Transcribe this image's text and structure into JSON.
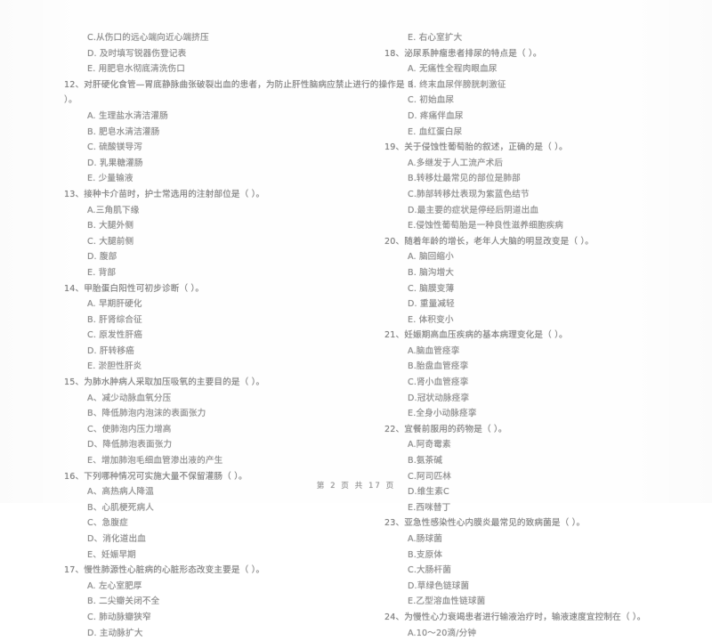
{
  "document": {
    "footer": "第 2 页 共 17 页"
  },
  "left_column": {
    "carryover_options": [
      "C.从伤口的远心端向近心端挤压",
      "D. 及时填写锐器伤登记表",
      "E. 用肥皂水彻底清洗伤口"
    ],
    "questions": [
      {
        "number": "12、",
        "stem": "对肝硬化食管—胃底静脉曲张破裂出血的患者，为防止肝性脑病应禁止进行的操作是（",
        "stem_cont": "）。",
        "options": [
          "A. 生理盐水清洁灌肠",
          "B. 肥皂水清洁灌肠",
          "C. 硫酸镁导泻",
          "D. 乳果糖灌肠",
          "E. 少量输液"
        ]
      },
      {
        "number": "13、",
        "stem": "接种卡介苗时，护士常选用的注射部位是（      ）。",
        "stem_cont": "",
        "options": [
          "A.三角肌下缘",
          "B. 大腿外侧",
          "C. 大腿前侧",
          "D. 腹部",
          "E. 背部"
        ]
      },
      {
        "number": "14、",
        "stem": "甲胎蛋白阳性可初步诊断（      ）。",
        "stem_cont": "",
        "options": [
          "A. 早期肝硬化",
          "B. 肝肾综合征",
          "C. 原发性肝癌",
          "D. 肝转移癌",
          "E. 淤胆性肝炎"
        ]
      },
      {
        "number": "15、",
        "stem": "为肺水肿病人采取加压吸氧的主要目的是（      ）。",
        "stem_cont": "",
        "options": [
          "A、减少动脉血氧分压",
          "B、降低肺泡内泡沫的表面张力",
          "C、使肺泡内压力增高",
          "D、降低肺泡表面张力",
          "E、增加肺泡毛细血管渗出液的产生"
        ]
      },
      {
        "number": "16、",
        "stem": "下列哪种情况可实施大量不保留灌肠（      ）。",
        "stem_cont": "",
        "options": [
          "A、高热病人降温",
          "B、心肌梗死病人",
          "C、急腹症",
          "D、消化道出血",
          "E、妊娠早期"
        ]
      },
      {
        "number": "17、",
        "stem": "慢性肺源性心脏病的心脏形态改变主要是（      ）。",
        "stem_cont": "",
        "options": [
          "A. 左心室肥厚",
          "B. 二尖瓣关闭不全",
          "C. 肺动脉瓣狭窄",
          "D. 主动脉扩大"
        ]
      }
    ]
  },
  "right_column": {
    "carryover_options": [
      "E. 右心室扩大"
    ],
    "questions": [
      {
        "number": "18、",
        "stem": "泌尿系肿瘤患者排尿的特点是（      ）。",
        "stem_cont": "",
        "options": [
          "A. 无痛性全程肉眼血尿",
          "B. 终末血尿伴膀胱刺激征",
          "C. 初始血尿",
          "D. 疼痛伴血尿",
          "E. 血红蛋白尿"
        ]
      },
      {
        "number": "19、",
        "stem": "关于侵蚀性葡萄胎的叙述，正确的是（      ）。",
        "stem_cont": "",
        "options": [
          "A.多继发于人工流产术后",
          "B.转移灶最常见的部位是肺部",
          "C.肺部转移灶表现为紫蓝色结节",
          "D.最主要的症状是停经后阴道出血",
          "E.侵蚀性葡萄胎是一种良性滋养细胞疾病"
        ]
      },
      {
        "number": "20、",
        "stem": "随着年龄的增长，老年人大脑的明显改变是（      ）。",
        "stem_cont": "",
        "options": [
          "A. 脑回缩小",
          "B. 脑沟增大",
          "C. 脑膜变薄",
          "D. 重量减轻",
          "E. 体积变小"
        ]
      },
      {
        "number": "21、",
        "stem": "妊娠期高血压疾病的基本病理变化是（      ）。",
        "stem_cont": "",
        "options": [
          "A.脑血管痉挛",
          "B.胎盘血管痉挛",
          "C.肾小血管痉挛",
          "D.冠状动脉痉挛",
          "E.全身小动脉痉挛"
        ]
      },
      {
        "number": "22、",
        "stem": "宜餐前服用的药物是（      ）。",
        "stem_cont": "",
        "options": [
          "A.阿奇霉素",
          "B.氨茶碱",
          "C.阿司匹林",
          "D.维生素C",
          "E.西咪替丁"
        ]
      },
      {
        "number": "23、",
        "stem": "亚急性感染性心内膜炎最常见的致病菌是（      ）。",
        "stem_cont": "",
        "options": [
          "A.肠球菌",
          "B.支原体",
          "C.大肠杆菌",
          "D.草绿色链球菌",
          "E.乙型溶血性链球菌"
        ]
      },
      {
        "number": "24、",
        "stem": "为慢性心力衰竭患者进行输液治疗时，输液速度宜控制在（      ）。",
        "stem_cont": "",
        "options": [
          "A.10～20滴/分钟"
        ]
      }
    ]
  }
}
